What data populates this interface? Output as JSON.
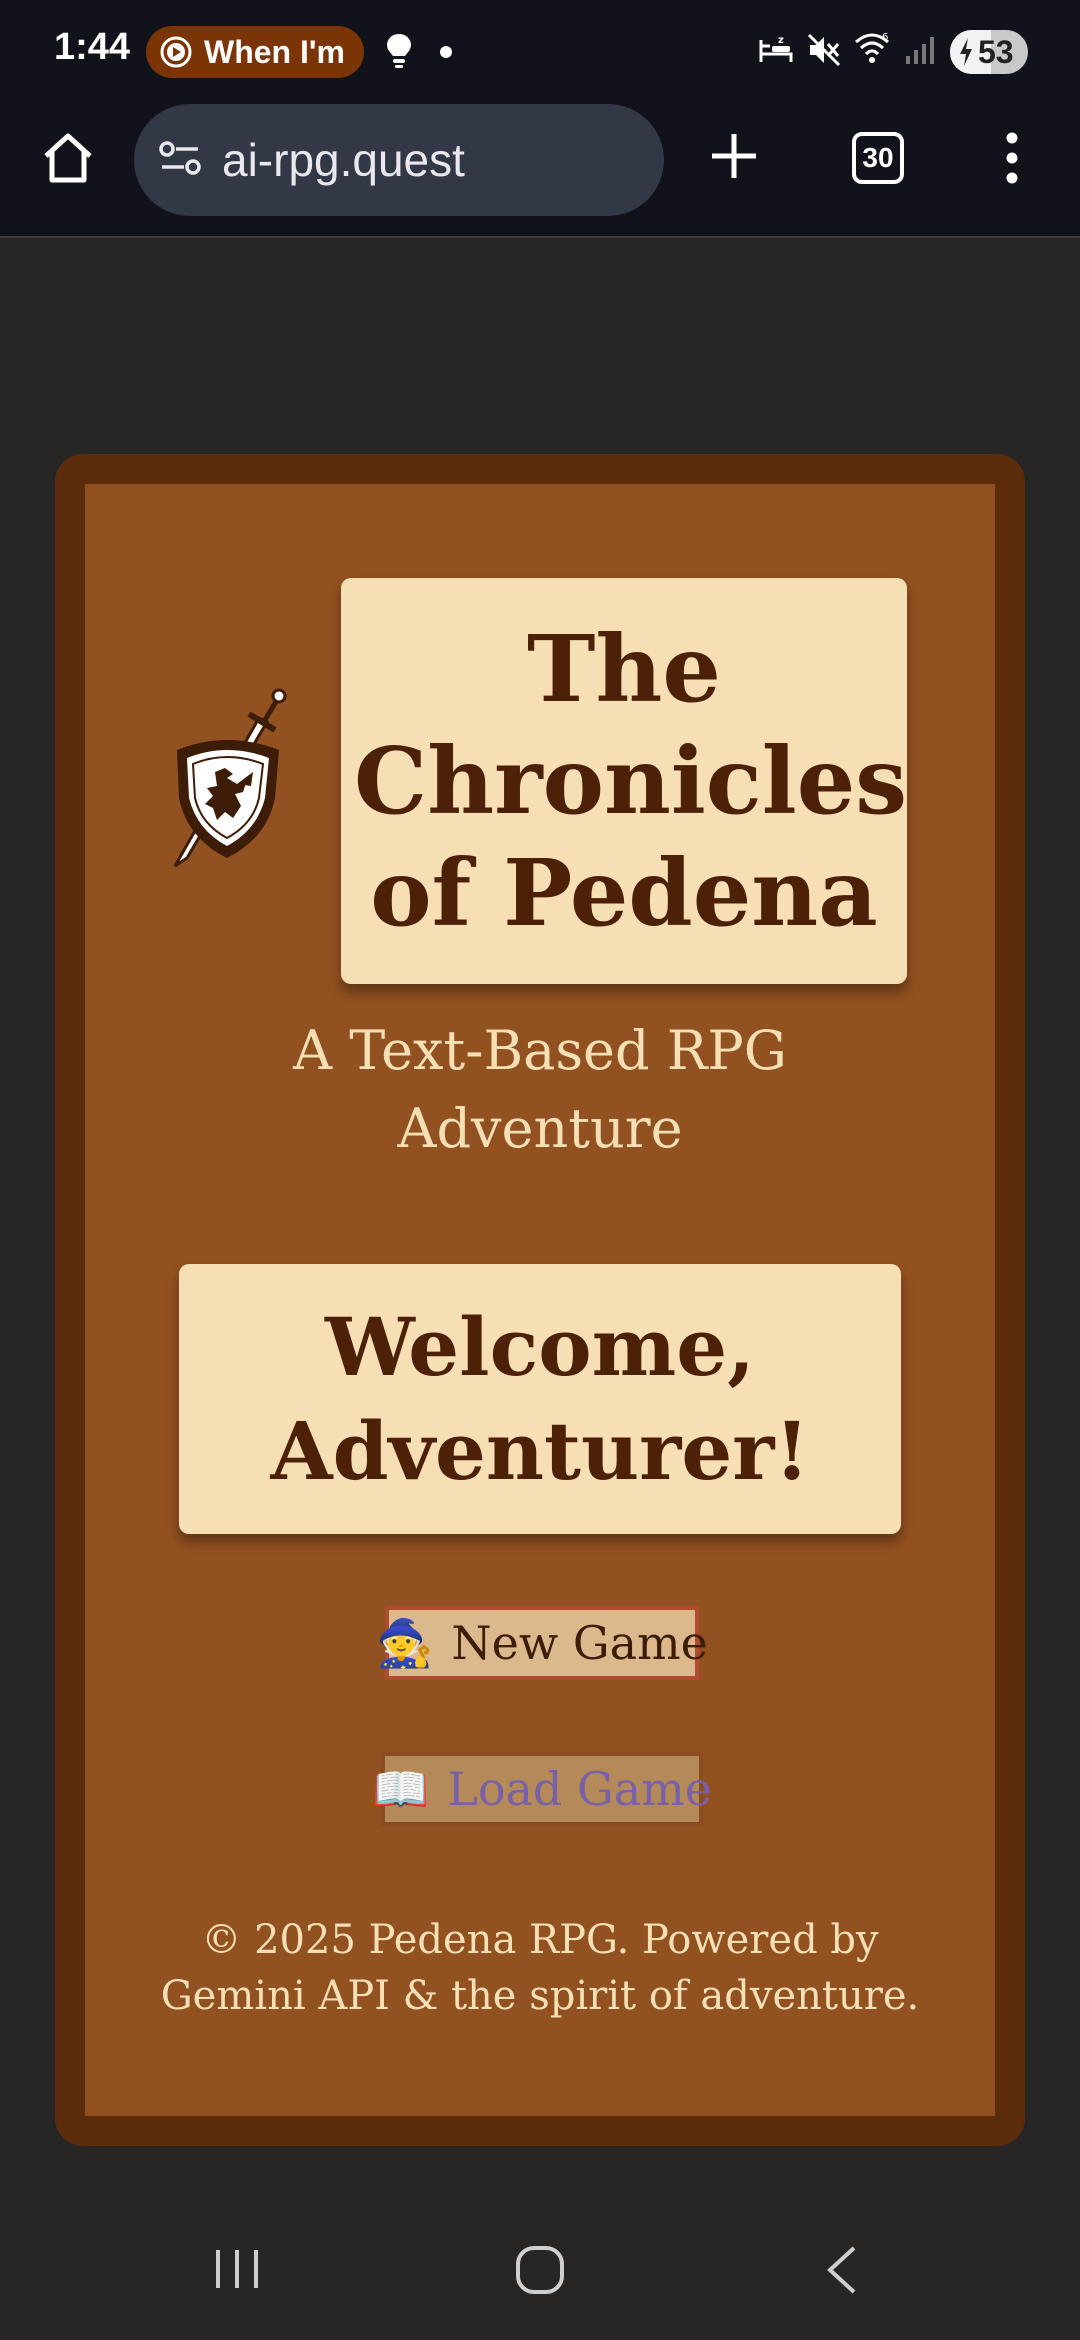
{
  "status_bar": {
    "time": "1:44",
    "media_pill_text": "When I'm",
    "battery_level": "53",
    "battery_fraction": 0.53,
    "icons": [
      "play-icon",
      "lightbulb-icon",
      "dot-icon",
      "sleep-icon",
      "mute-icon",
      "wifi-icon",
      "signal-icon",
      "battery-charging-icon"
    ]
  },
  "browser": {
    "url": "ai-rpg.quest",
    "tab_count": "30",
    "icons": [
      "home-icon",
      "site-settings-icon",
      "new-tab-icon",
      "tabs-icon",
      "more-menu-icon"
    ]
  },
  "page": {
    "title": "The Chronicles of Pedena",
    "subtitle_line1": "A Text-Based RPG",
    "subtitle_line2": "Adventure",
    "welcome": "Welcome, Adventurer!",
    "new_game_label": "New Game",
    "new_game_icon": "🧙",
    "load_game_label": "Load Game",
    "load_game_icon": "📖",
    "footer_line1": "© 2025 Pedena RPG. Powered by",
    "footer_line2": "Gemini API & the spirit of adventure.",
    "logo": "shield-sword-dragon-icon"
  },
  "nav_bar": {
    "icons": [
      "recent-apps-icon",
      "home-button-icon",
      "back-icon"
    ]
  },
  "colors": {
    "frame": "#5b2d0d",
    "panel": "#925120",
    "parchment": "#f6dfb5",
    "ink": "#4d2108",
    "load_text": "#7861a8"
  }
}
